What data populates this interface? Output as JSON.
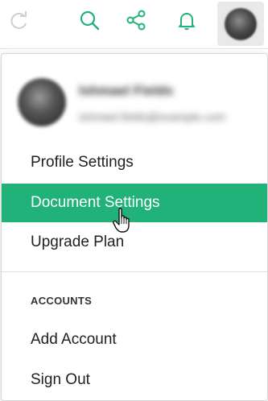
{
  "topbar": {
    "icons": [
      "redo-icon",
      "search-icon",
      "share-icon",
      "notification-bell-icon"
    ],
    "accent_color": "#21b27a"
  },
  "menu": {
    "profile": {
      "name": "Ishmael Fields",
      "email": "ishmael.fields@example.com"
    },
    "items": [
      {
        "label": "Profile Settings"
      },
      {
        "label": "Document Settings",
        "highlighted": true,
        "color": "#21b27a"
      },
      {
        "label": "Upgrade Plan"
      }
    ],
    "accounts_section": {
      "heading": "ACCOUNTS",
      "items": [
        {
          "label": "Add Account"
        },
        {
          "label": "Sign Out"
        }
      ]
    }
  }
}
